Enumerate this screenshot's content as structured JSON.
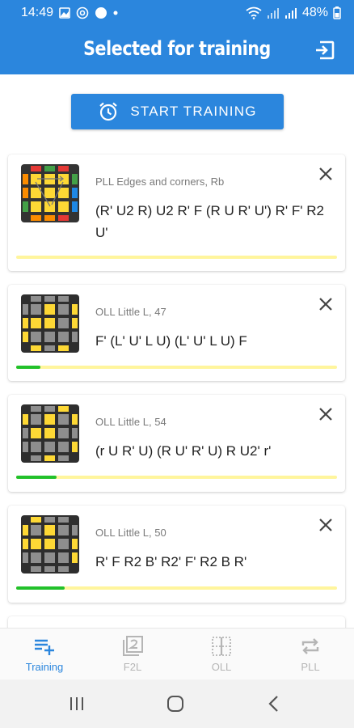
{
  "status_bar": {
    "time": "14:49",
    "battery": "48%"
  },
  "app_bar": {
    "title": "Selected for training"
  },
  "start_button": {
    "label": "START TRAINING"
  },
  "colors": {
    "primary": "#2b86dd",
    "progress_track": "#fff59d",
    "progress_fill": "#22c12a"
  },
  "cards": [
    {
      "name": "PLL Edges and corners, Rb",
      "algorithm": "(R' U2 R) U2 R' F (R U R' U') R' F' R2 U'",
      "progress": 0.0,
      "cube": "pll"
    },
    {
      "name": "OLL Little L, 47",
      "algorithm": "F' (L' U' L U) (L' U' L U) F",
      "progress": 0.075,
      "cube": "oll47"
    },
    {
      "name": "OLL Little L, 54",
      "algorithm": "(r U R' U) (R U' R' U) R U2' r'",
      "progress": 0.125,
      "cube": "oll54"
    },
    {
      "name": "OLL Little L, 50",
      "algorithm": "R' F R2 B' R2' F' R2 B R'",
      "progress": 0.15,
      "cube": "oll50"
    }
  ],
  "bottom_nav": [
    {
      "label": "Training",
      "icon": "playlist-add-icon",
      "active": true
    },
    {
      "label": "F2L",
      "icon": "f2l-icon",
      "active": false
    },
    {
      "label": "OLL",
      "icon": "oll-grid-icon",
      "active": false
    },
    {
      "label": "PLL",
      "icon": "repeat-icon",
      "active": false
    }
  ]
}
